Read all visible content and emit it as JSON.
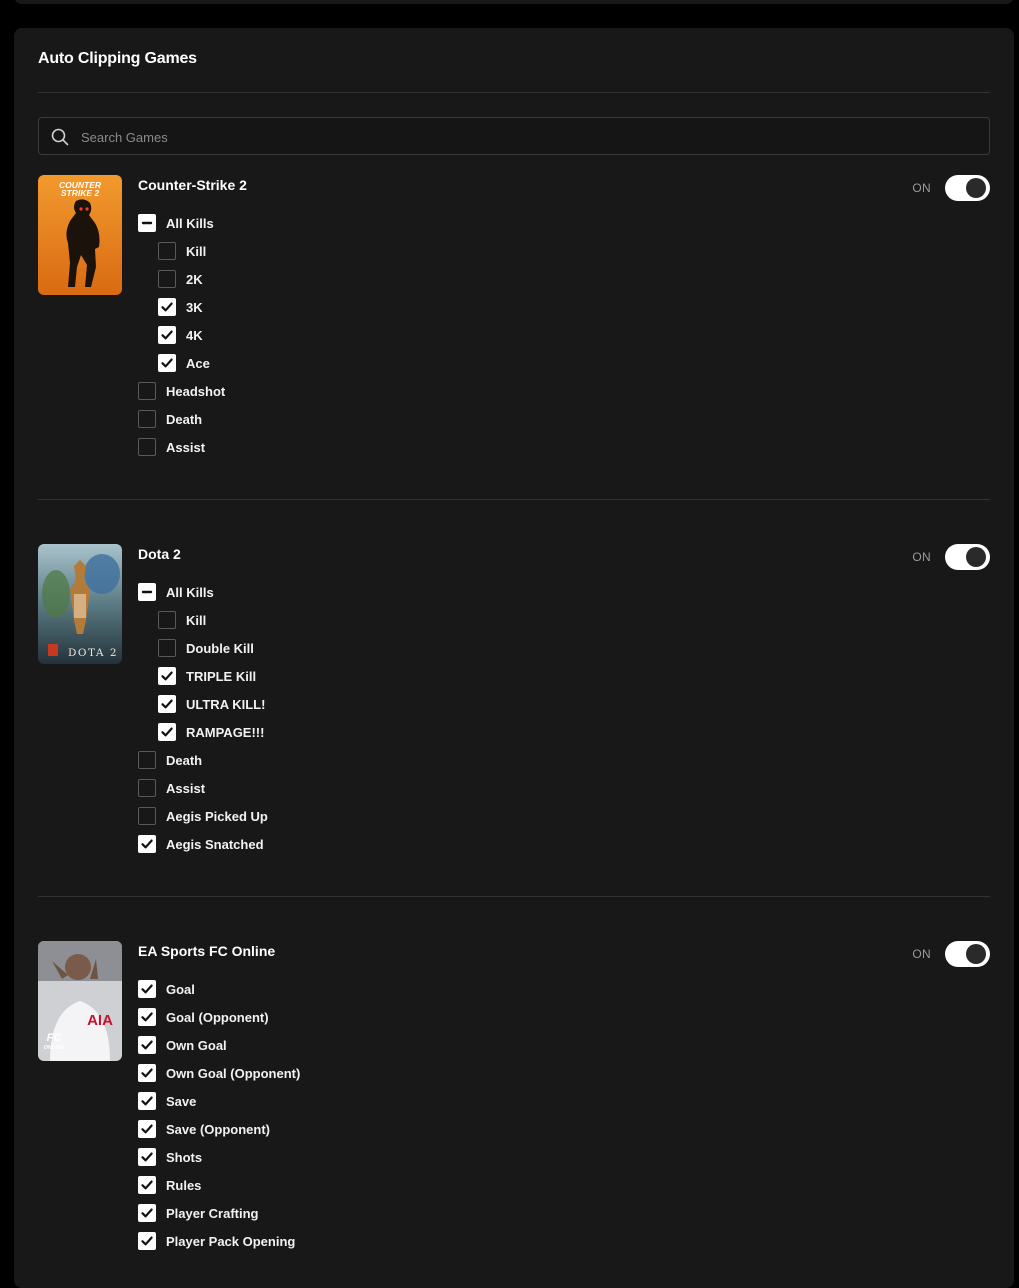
{
  "section_title": "Auto Clipping Games",
  "search": {
    "placeholder": "Search Games",
    "value": ""
  },
  "toggle_label": "ON",
  "games": [
    {
      "name": "Counter-Strike 2",
      "cover_text": [
        "COUNTER",
        "STRIKE 2"
      ],
      "enabled": true,
      "options": [
        {
          "label": "All Kills",
          "state": "partial",
          "level": 0
        },
        {
          "label": "Kill",
          "state": "off",
          "level": 1
        },
        {
          "label": "2K",
          "state": "off",
          "level": 1
        },
        {
          "label": "3K",
          "state": "on",
          "level": 1
        },
        {
          "label": "4K",
          "state": "on",
          "level": 1
        },
        {
          "label": "Ace",
          "state": "on",
          "level": 1
        },
        {
          "label": "Headshot",
          "state": "off",
          "level": 0
        },
        {
          "label": "Death",
          "state": "off",
          "level": 0
        },
        {
          "label": "Assist",
          "state": "off",
          "level": 0
        }
      ]
    },
    {
      "name": "Dota 2",
      "cover_text": [
        "DOTA 2"
      ],
      "enabled": true,
      "options": [
        {
          "label": "All Kills",
          "state": "partial",
          "level": 0
        },
        {
          "label": "Kill",
          "state": "off",
          "level": 1
        },
        {
          "label": "Double Kill",
          "state": "off",
          "level": 1
        },
        {
          "label": "TRIPLE Kill",
          "state": "on",
          "level": 1
        },
        {
          "label": "ULTRA KILL!",
          "state": "on",
          "level": 1
        },
        {
          "label": "RAMPAGE!!!",
          "state": "on",
          "level": 1
        },
        {
          "label": "Death",
          "state": "off",
          "level": 0
        },
        {
          "label": "Assist",
          "state": "off",
          "level": 0
        },
        {
          "label": "Aegis Picked Up",
          "state": "off",
          "level": 0
        },
        {
          "label": "Aegis Snatched",
          "state": "on",
          "level": 0
        }
      ]
    },
    {
      "name": "EA Sports FC Online",
      "cover_text": [
        "FC",
        "ONLINE",
        "AIA"
      ],
      "enabled": true,
      "options": [
        {
          "label": "Goal",
          "state": "on",
          "level": 0
        },
        {
          "label": "Goal (Opponent)",
          "state": "on",
          "level": 0
        },
        {
          "label": "Own Goal",
          "state": "on",
          "level": 0
        },
        {
          "label": "Own Goal (Opponent)",
          "state": "on",
          "level": 0
        },
        {
          "label": "Save",
          "state": "on",
          "level": 0
        },
        {
          "label": "Save (Opponent)",
          "state": "on",
          "level": 0
        },
        {
          "label": "Shots",
          "state": "on",
          "level": 0
        },
        {
          "label": "Rules",
          "state": "on",
          "level": 0
        },
        {
          "label": "Player Crafting",
          "state": "on",
          "level": 0
        },
        {
          "label": "Player Pack Opening",
          "state": "on",
          "level": 0
        }
      ]
    }
  ],
  "colors": {
    "panel_bg": "#181818",
    "page_bg": "#000000",
    "divider": "#333333",
    "checkbox_on": "#ffffff",
    "cs2_cover": "#e8821e",
    "dota_cover": "#5a7a86",
    "fc_cover": "#d9d9dc"
  },
  "icons": {
    "search": "search-icon",
    "checked": "checkmark-icon",
    "partial": "minus-icon"
  }
}
